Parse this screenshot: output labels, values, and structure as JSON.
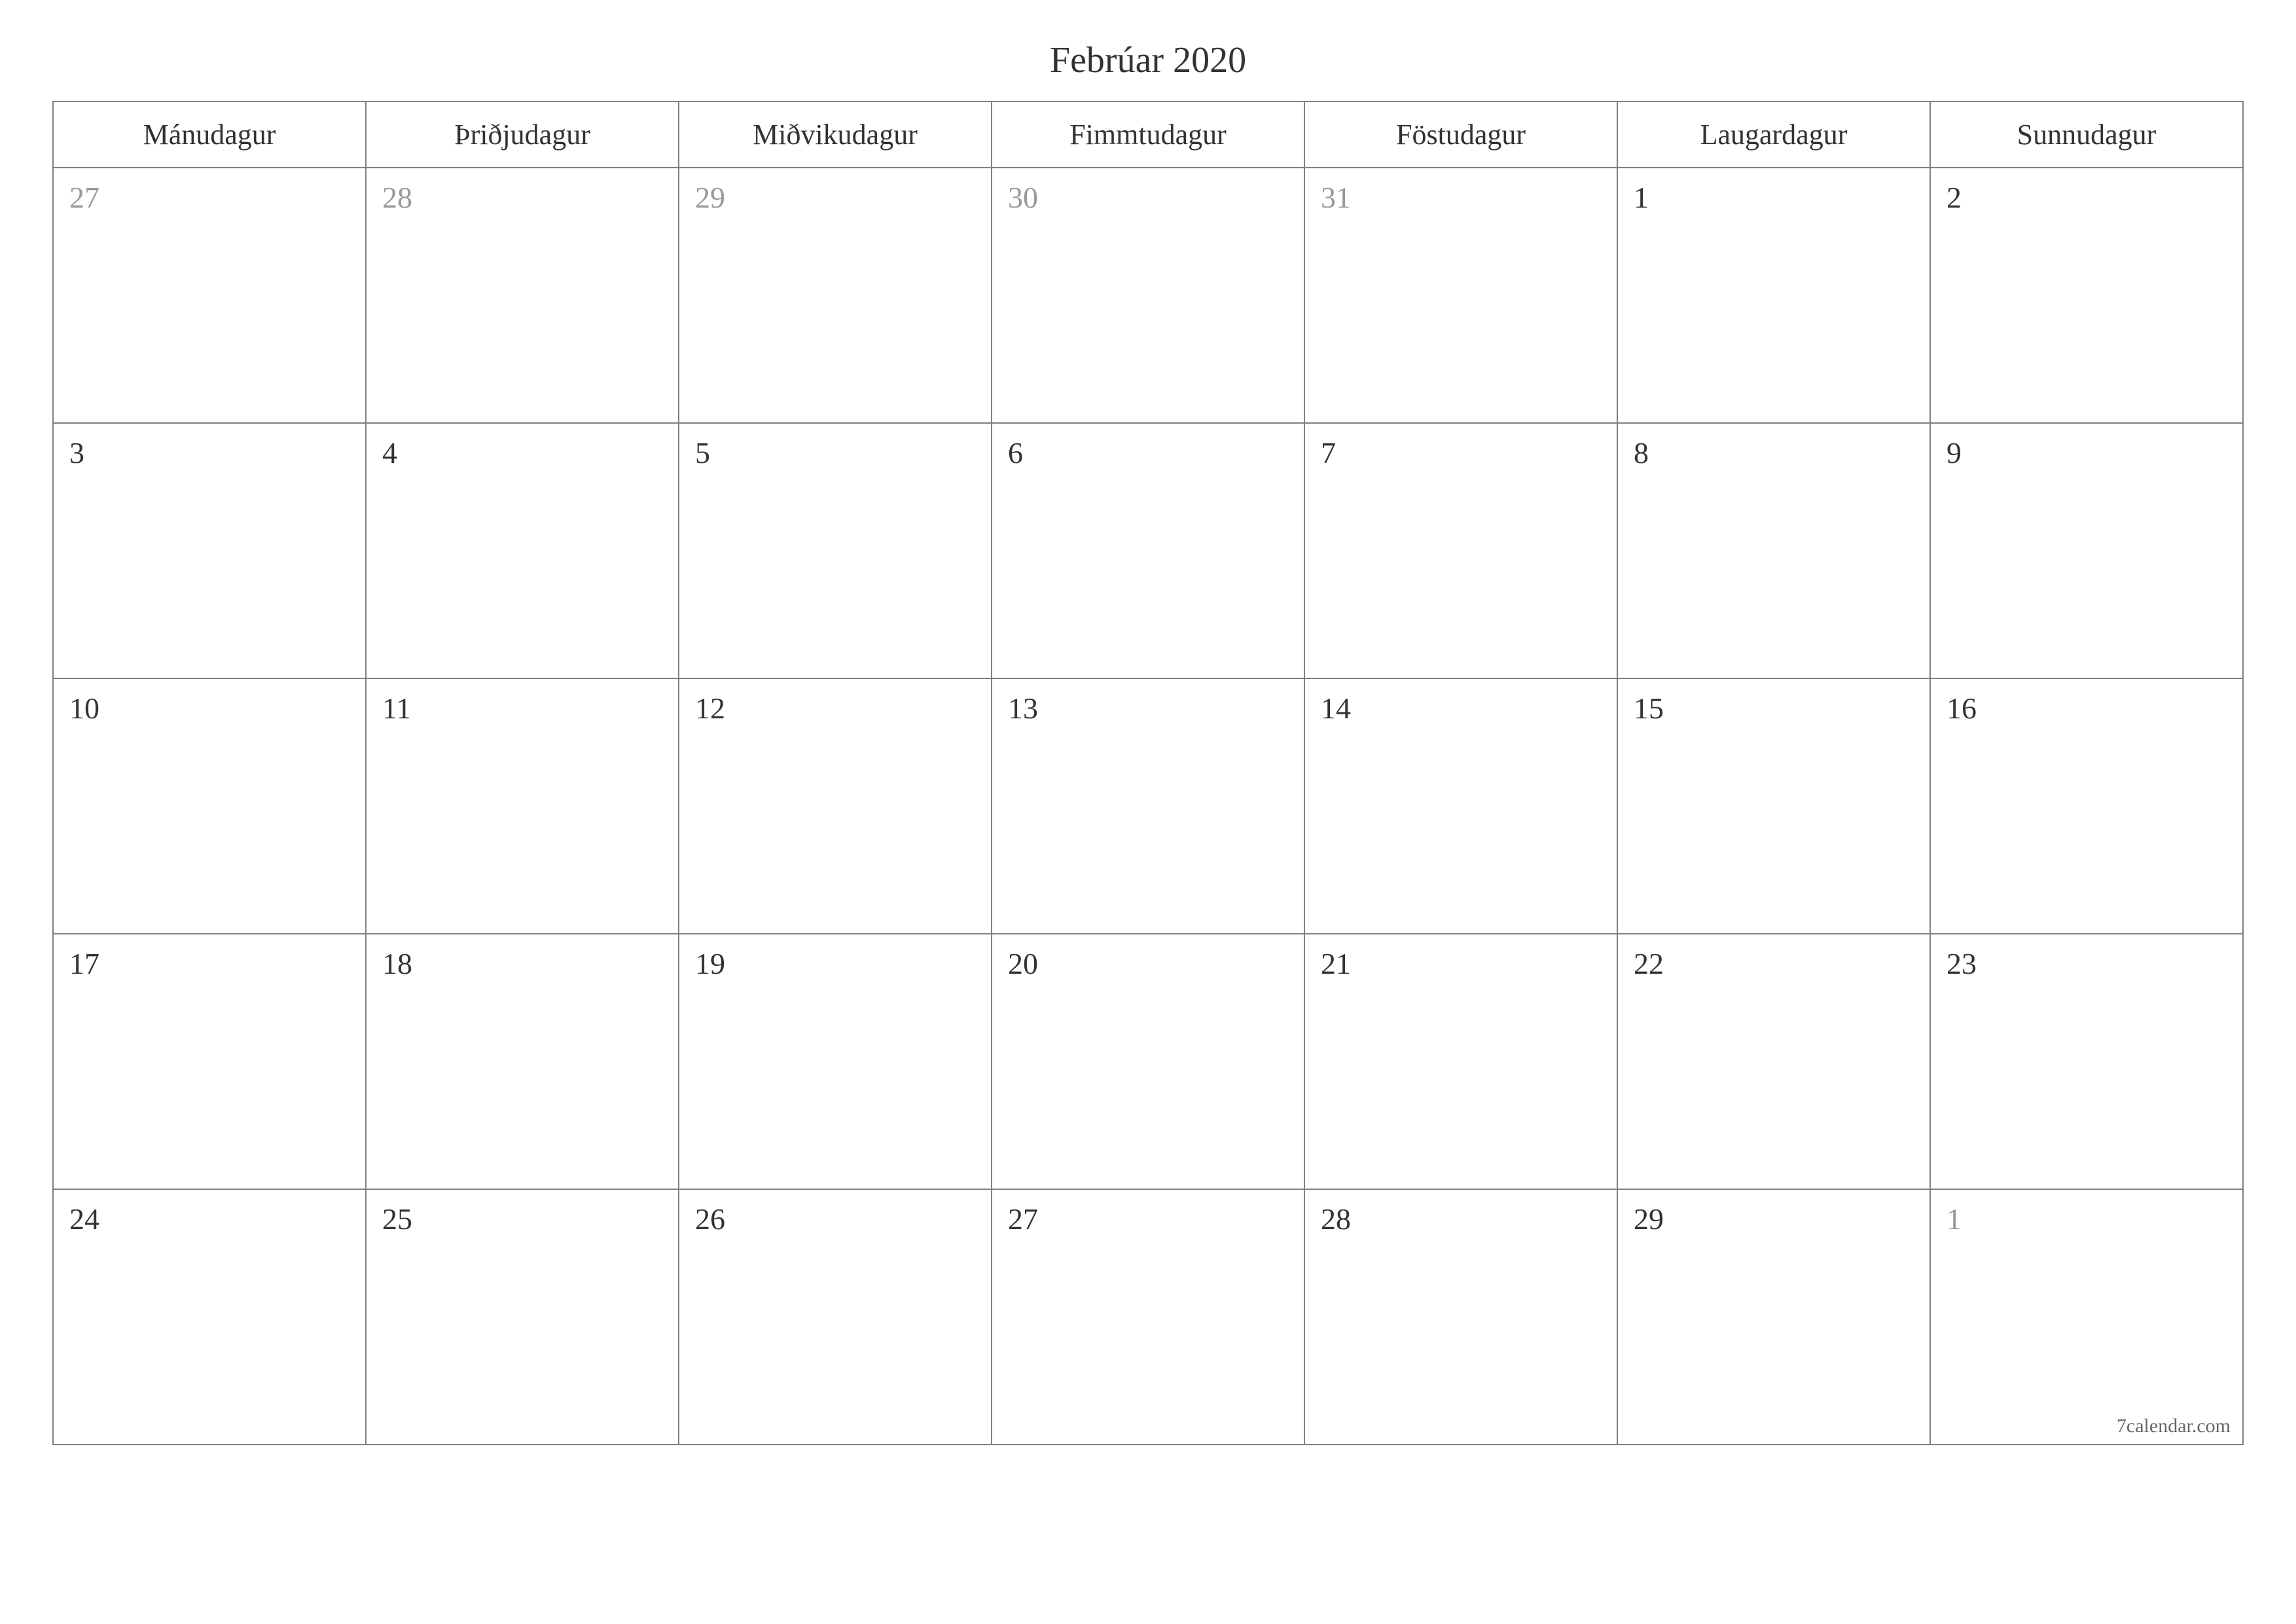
{
  "title": "Febrúar 2020",
  "weekdays": [
    "Mánudagur",
    "Þriðjudagur",
    "Miðvikudagur",
    "Fimmtudagur",
    "Föstudagur",
    "Laugardagur",
    "Sunnudagur"
  ],
  "weeks": [
    [
      {
        "day": "27",
        "otherMonth": true
      },
      {
        "day": "28",
        "otherMonth": true
      },
      {
        "day": "29",
        "otherMonth": true
      },
      {
        "day": "30",
        "otherMonth": true
      },
      {
        "day": "31",
        "otherMonth": true
      },
      {
        "day": "1",
        "otherMonth": false
      },
      {
        "day": "2",
        "otherMonth": false
      }
    ],
    [
      {
        "day": "3",
        "otherMonth": false
      },
      {
        "day": "4",
        "otherMonth": false
      },
      {
        "day": "5",
        "otherMonth": false
      },
      {
        "day": "6",
        "otherMonth": false
      },
      {
        "day": "7",
        "otherMonth": false
      },
      {
        "day": "8",
        "otherMonth": false
      },
      {
        "day": "9",
        "otherMonth": false
      }
    ],
    [
      {
        "day": "10",
        "otherMonth": false
      },
      {
        "day": "11",
        "otherMonth": false
      },
      {
        "day": "12",
        "otherMonth": false
      },
      {
        "day": "13",
        "otherMonth": false
      },
      {
        "day": "14",
        "otherMonth": false
      },
      {
        "day": "15",
        "otherMonth": false
      },
      {
        "day": "16",
        "otherMonth": false
      }
    ],
    [
      {
        "day": "17",
        "otherMonth": false
      },
      {
        "day": "18",
        "otherMonth": false
      },
      {
        "day": "19",
        "otherMonth": false
      },
      {
        "day": "20",
        "otherMonth": false
      },
      {
        "day": "21",
        "otherMonth": false
      },
      {
        "day": "22",
        "otherMonth": false
      },
      {
        "day": "23",
        "otherMonth": false
      }
    ],
    [
      {
        "day": "24",
        "otherMonth": false
      },
      {
        "day": "25",
        "otherMonth": false
      },
      {
        "day": "26",
        "otherMonth": false
      },
      {
        "day": "27",
        "otherMonth": false
      },
      {
        "day": "28",
        "otherMonth": false
      },
      {
        "day": "29",
        "otherMonth": false
      },
      {
        "day": "1",
        "otherMonth": true
      }
    ]
  ],
  "footer": "7calendar.com"
}
